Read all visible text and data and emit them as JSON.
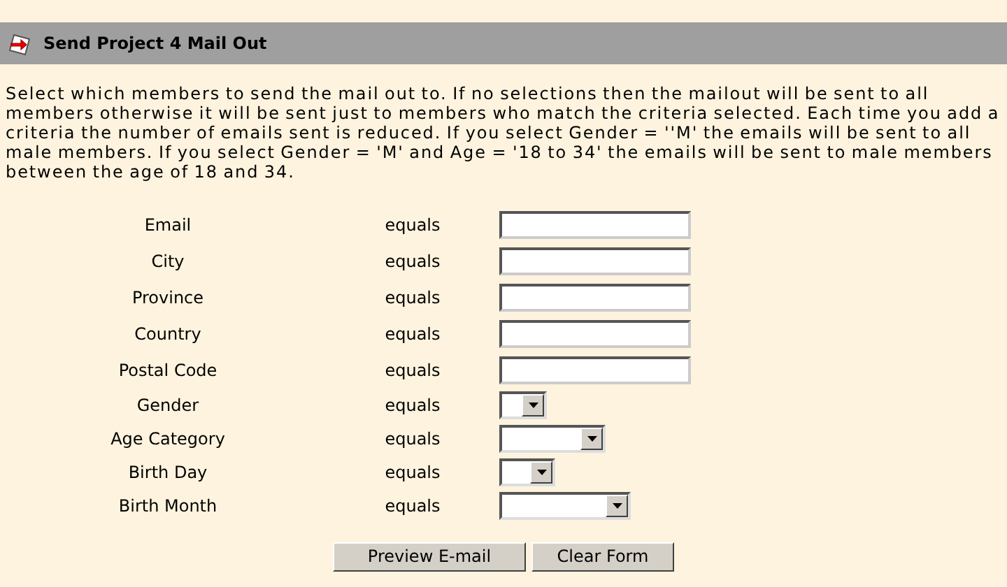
{
  "header": {
    "title": "Send Project 4 Mail Out"
  },
  "intro": "Select which members to send the mail out to. If no selections then the mailout will be sent to all members otherwise it will be sent just to members who match the criteria selected. Each time you add a criteria the number of emails sent is reduced. If you select Gender = ''M' the emails will be sent to all male members. If you select Gender = 'M' and Age = '18 to 34' the emails will be sent to male members between the age of 18 and 34.",
  "criteria": [
    {
      "label": "Email",
      "operator": "equals",
      "kind": "text"
    },
    {
      "label": "City",
      "operator": "equals",
      "kind": "text"
    },
    {
      "label": "Province",
      "operator": "equals",
      "kind": "text"
    },
    {
      "label": "Country",
      "operator": "equals",
      "kind": "text"
    },
    {
      "label": "Postal Code",
      "operator": "equals",
      "kind": "text"
    },
    {
      "label": "Gender",
      "operator": "equals",
      "kind": "select"
    },
    {
      "label": "Age Category",
      "operator": "equals",
      "kind": "select"
    },
    {
      "label": "Birth Day",
      "operator": "equals",
      "kind": "select"
    },
    {
      "label": "Birth Month",
      "operator": "equals",
      "kind": "select"
    }
  ],
  "buttons": [
    "Preview E-mail",
    "Clear Form"
  ]
}
